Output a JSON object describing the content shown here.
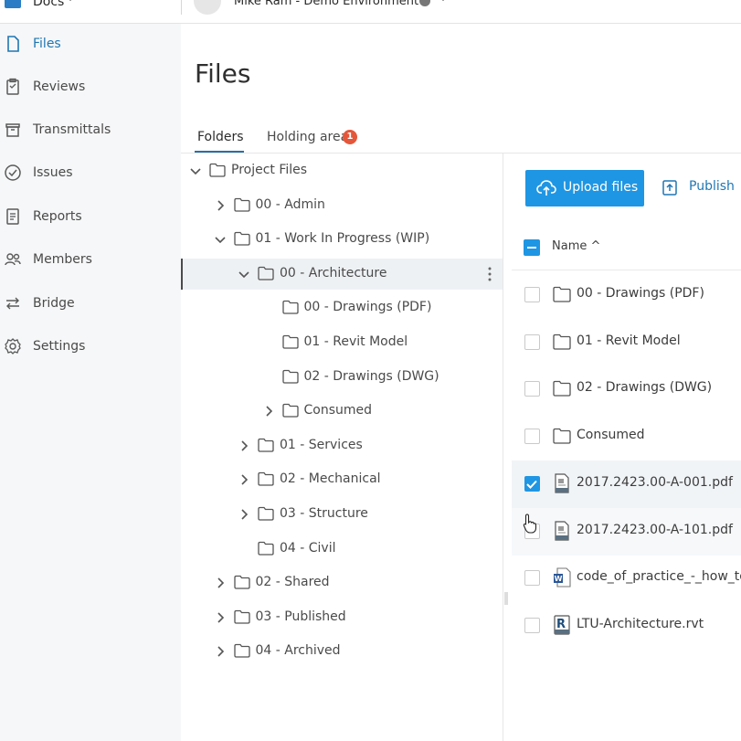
{
  "topbar": {
    "app_name": "Docs",
    "environment": "Mike Ram - Demo Environment"
  },
  "nav": [
    {
      "id": "files",
      "label": "Files",
      "icon": "file-icon",
      "active": true
    },
    {
      "id": "reviews",
      "label": "Reviews",
      "icon": "clipboard-icon"
    },
    {
      "id": "transmittals",
      "label": "Transmittals",
      "icon": "archive-icon"
    },
    {
      "id": "issues",
      "label": "Issues",
      "icon": "check-circle-icon"
    },
    {
      "id": "reports",
      "label": "Reports",
      "icon": "report-icon"
    },
    {
      "id": "members",
      "label": "Members",
      "icon": "members-icon"
    },
    {
      "id": "bridge",
      "label": "Bridge",
      "icon": "bridge-icon"
    },
    {
      "id": "settings",
      "label": "Settings",
      "icon": "gear-icon"
    }
  ],
  "page": {
    "title": "Files",
    "tabs": [
      {
        "label": "Folders",
        "active": true
      },
      {
        "label": "Holding area",
        "badge": "1"
      }
    ]
  },
  "tree": [
    {
      "label": "Project Files",
      "chevron": "down"
    },
    {
      "label": "00 - Admin",
      "chevron": "right"
    },
    {
      "label": "01 - Work In Progress (WIP)",
      "chevron": "down"
    },
    {
      "label": "00 - Architecture",
      "chevron": "down",
      "selected": true
    },
    {
      "label": "00 - Drawings (PDF)",
      "chevron": "none"
    },
    {
      "label": "01 - Revit Model",
      "chevron": "none"
    },
    {
      "label": "02 - Drawings (DWG)",
      "chevron": "none"
    },
    {
      "label": "Consumed",
      "chevron": "right"
    },
    {
      "label": "01 - Services",
      "chevron": "right"
    },
    {
      "label": "02 - Mechanical",
      "chevron": "right"
    },
    {
      "label": "03 - Structure",
      "chevron": "right"
    },
    {
      "label": "04 - Civil",
      "chevron": "none"
    },
    {
      "label": "02 - Shared",
      "chevron": "right"
    },
    {
      "label": "03 - Published",
      "chevron": "right"
    },
    {
      "label": "04 - Archived",
      "chevron": "right"
    }
  ],
  "toolbar": {
    "upload_label": "Upload files",
    "publish_label": "Publish"
  },
  "files_table": {
    "name_header": "Name ^",
    "rows": [
      {
        "name": "00 - Drawings (PDF)",
        "type": "folder",
        "checked": false
      },
      {
        "name": "01 - Revit Model",
        "type": "folder",
        "checked": false
      },
      {
        "name": "02 - Drawings (DWG)",
        "type": "folder",
        "checked": false
      },
      {
        "name": "Consumed",
        "type": "folder",
        "checked": false
      },
      {
        "name": "2017.2423.00-A-001.pdf",
        "type": "pdf",
        "checked": true
      },
      {
        "name": "2017.2423.00-A-101.pdf",
        "type": "pdf",
        "checked": false
      },
      {
        "name": "code_of_practice_-_how_to_",
        "type": "word",
        "checked": false
      },
      {
        "name": "LTU-Architecture.rvt",
        "type": "revit",
        "checked": false
      }
    ]
  },
  "colors": {
    "accent": "#1f96e3",
    "active_nav": "#1f76b3",
    "badge": "#e4573a"
  }
}
